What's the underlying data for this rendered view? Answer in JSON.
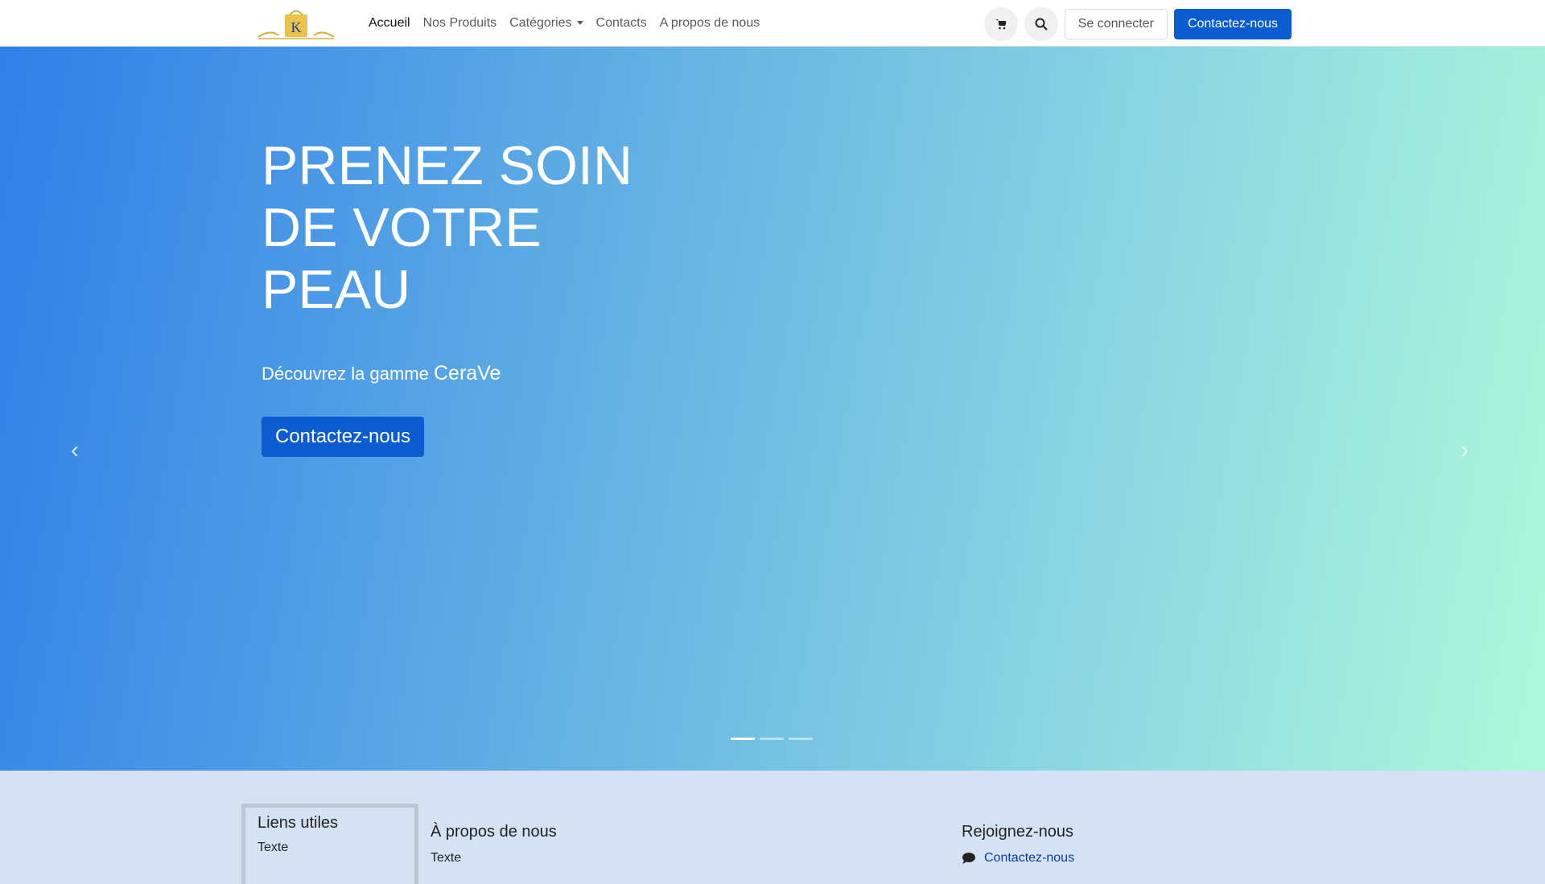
{
  "nav": {
    "items": [
      {
        "label": "Accueil",
        "active": true
      },
      {
        "label": "Nos Produits"
      },
      {
        "label": "Catégories",
        "dropdown": true
      },
      {
        "label": "Contacts"
      },
      {
        "label": "A propos de nous"
      }
    ],
    "logo_letter": "K",
    "login": "Se connecter",
    "contact": "Contactez-nous"
  },
  "hero": {
    "title": "PRENEZ SOIN DE VOTRE PEAU",
    "subtitle": "Découvrez la gamme",
    "brand": "CeraVe",
    "button": "Contactez-nous",
    "slides": 3,
    "active_slide": 1
  },
  "footer": {
    "links_title": "Liens utiles",
    "links_text": "Texte",
    "about_title": "À propos de nous",
    "about_text": "Texte",
    "join_title": "Rejoignez-nous",
    "join_link": "Contactez-nous"
  },
  "colors": {
    "primary": "#0b5bd1",
    "footer_bg": "#d4e2f4"
  }
}
